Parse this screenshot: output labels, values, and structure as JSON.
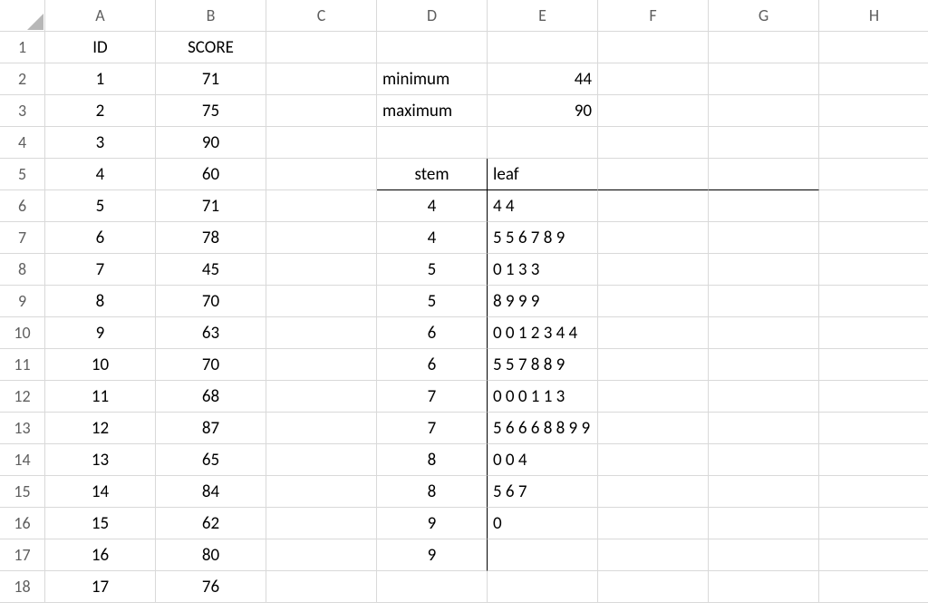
{
  "columns": [
    "A",
    "B",
    "C",
    "D",
    "E",
    "F",
    "G",
    "H"
  ],
  "row_count": 18,
  "table": {
    "headers": {
      "A": "ID",
      "B": "SCORE"
    },
    "rows": [
      {
        "id": 1,
        "score": 71
      },
      {
        "id": 2,
        "score": 75
      },
      {
        "id": 3,
        "score": 90
      },
      {
        "id": 4,
        "score": 60
      },
      {
        "id": 5,
        "score": 71
      },
      {
        "id": 6,
        "score": 78
      },
      {
        "id": 7,
        "score": 45
      },
      {
        "id": 8,
        "score": 70
      },
      {
        "id": 9,
        "score": 63
      },
      {
        "id": 10,
        "score": 70
      },
      {
        "id": 11,
        "score": 68
      },
      {
        "id": 12,
        "score": 87
      },
      {
        "id": 13,
        "score": 65
      },
      {
        "id": 14,
        "score": 84
      },
      {
        "id": 15,
        "score": 62
      },
      {
        "id": 16,
        "score": 80
      },
      {
        "id": 17,
        "score": 76
      }
    ]
  },
  "stats": {
    "min_label": "minimum",
    "min_value": 44,
    "max_label": "maximum",
    "max_value": 90
  },
  "stemleaf": {
    "stem_header": "stem",
    "leaf_header": "leaf",
    "rows": [
      {
        "stem": 4,
        "leaf": "4 4"
      },
      {
        "stem": 4,
        "leaf": "5 5 6 7 8 9"
      },
      {
        "stem": 5,
        "leaf": "0 1 3 3"
      },
      {
        "stem": 5,
        "leaf": "8 9 9 9"
      },
      {
        "stem": 6,
        "leaf": "0 0 1 2 3 4 4"
      },
      {
        "stem": 6,
        "leaf": "5 5 7 8 8 9"
      },
      {
        "stem": 7,
        "leaf": "0 0 0 1 1 3"
      },
      {
        "stem": 7,
        "leaf": "5 6 6 6 8 8 9 9"
      },
      {
        "stem": 8,
        "leaf": "0 0 4"
      },
      {
        "stem": 8,
        "leaf": "5 6 7"
      },
      {
        "stem": 9,
        "leaf": "0"
      },
      {
        "stem": 9,
        "leaf": ""
      }
    ]
  },
  "chart_data": {
    "type": "table",
    "title": "Stem-and-leaf plot of SCORE",
    "stem_unit": 10,
    "leaf_unit": 1,
    "minimum": 44,
    "maximum": 90,
    "stems": [
      {
        "stem": 4,
        "leaves": [
          4,
          4
        ]
      },
      {
        "stem": 4,
        "leaves": [
          5,
          5,
          6,
          7,
          8,
          9
        ]
      },
      {
        "stem": 5,
        "leaves": [
          0,
          1,
          3,
          3
        ]
      },
      {
        "stem": 5,
        "leaves": [
          8,
          9,
          9,
          9
        ]
      },
      {
        "stem": 6,
        "leaves": [
          0,
          0,
          1,
          2,
          3,
          4,
          4
        ]
      },
      {
        "stem": 6,
        "leaves": [
          5,
          5,
          7,
          8,
          8,
          9
        ]
      },
      {
        "stem": 7,
        "leaves": [
          0,
          0,
          0,
          1,
          1,
          3
        ]
      },
      {
        "stem": 7,
        "leaves": [
          5,
          6,
          6,
          6,
          8,
          8,
          9,
          9
        ]
      },
      {
        "stem": 8,
        "leaves": [
          0,
          0,
          4
        ]
      },
      {
        "stem": 8,
        "leaves": [
          5,
          6,
          7
        ]
      },
      {
        "stem": 9,
        "leaves": [
          0
        ]
      },
      {
        "stem": 9,
        "leaves": []
      }
    ]
  }
}
